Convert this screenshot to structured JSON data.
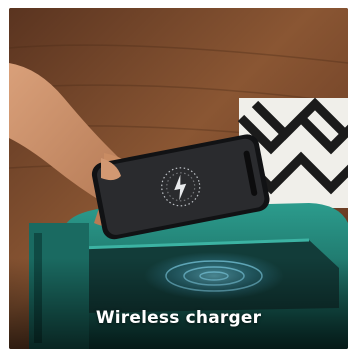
{
  "caption": "Wireless charger",
  "colors": {
    "wood_dark": "#3a2418",
    "wood_mid": "#6b3d24",
    "wood_light": "#9a6a45",
    "charger_teal": "#1f7a70",
    "charger_teal_light": "#2c9c8d",
    "phone_screen": "#2a2b2e",
    "rug_black": "#1b1b1b",
    "rug_white": "#f0efea",
    "glow": "#7fe0ff"
  },
  "icons": {
    "charging_indicator": "lightning-bolt-icon"
  }
}
